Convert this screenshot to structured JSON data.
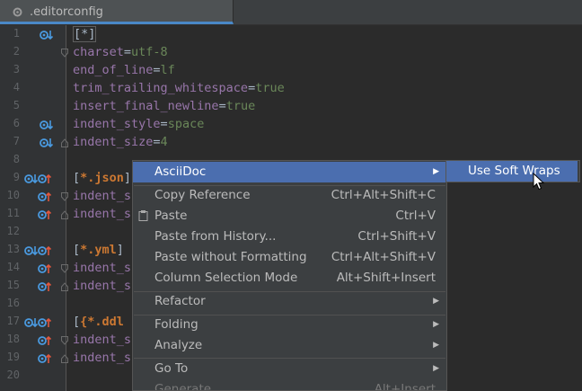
{
  "tab": {
    "filename": ".editorconfig"
  },
  "gutter": {
    "line_numbers": [
      "1",
      "2",
      "3",
      "4",
      "5",
      "6",
      "7",
      "8",
      "9",
      "10",
      "11",
      "12",
      "13",
      "14",
      "15",
      "16",
      "17",
      "18",
      "19",
      "20"
    ]
  },
  "code": {
    "line1": "[*]",
    "line2_key": "charset",
    "line2_val": "utf-8",
    "line3_key": "end_of_line",
    "line3_val": "lf",
    "line4_key": "trim_trailing_whitespace",
    "line4_val": "true",
    "line5_key": "insert_final_newline",
    "line5_val": "true",
    "line6_key": "indent_style",
    "line6_val": "space",
    "line7_key": "indent_size",
    "line7_val": "4",
    "line9_open": "[",
    "line9_section": "*.json",
    "line9_rest": "]",
    "line10": "indent_s",
    "line11": "indent_s",
    "line13_open": "[",
    "line13_section": "*.yml",
    "line13_rest": "]",
    "line14": "indent_s",
    "line15": "indent_s",
    "line17_open": "[",
    "line17_section": "{*.ddl",
    "line17_rest": "",
    "line18": "indent_s",
    "line19": "indent_s",
    "eq": "="
  },
  "context_menu": {
    "items": [
      {
        "label": "AsciiDoc",
        "shortcut": "",
        "submenu": true
      },
      {
        "label": "Copy Reference",
        "shortcut": "Ctrl+Alt+Shift+C"
      },
      {
        "label": "Paste",
        "shortcut": "Ctrl+V"
      },
      {
        "label": "Paste from History...",
        "shortcut": "Ctrl+Shift+V"
      },
      {
        "label": "Paste without Formatting",
        "shortcut": "Ctrl+Alt+Shift+V"
      },
      {
        "label": "Column Selection Mode",
        "shortcut": "Alt+Shift+Insert"
      },
      {
        "label": "Refactor",
        "shortcut": "",
        "submenu": true
      },
      {
        "label": "Folding",
        "shortcut": "",
        "submenu": true
      },
      {
        "label": "Analyze",
        "shortcut": "",
        "submenu": true
      },
      {
        "label": "Go To",
        "shortcut": "",
        "submenu": true
      },
      {
        "label": "Generate",
        "shortcut": "Alt+Insert"
      }
    ],
    "arrow": "▶"
  },
  "submenu": {
    "items": [
      {
        "label": "Use Soft Wraps"
      }
    ]
  },
  "colors": {
    "accent": "#4b6eaf",
    "background": "#2b2b2b",
    "keyword": "#9876aa",
    "value": "#6a8759",
    "section": "#cc7832"
  }
}
